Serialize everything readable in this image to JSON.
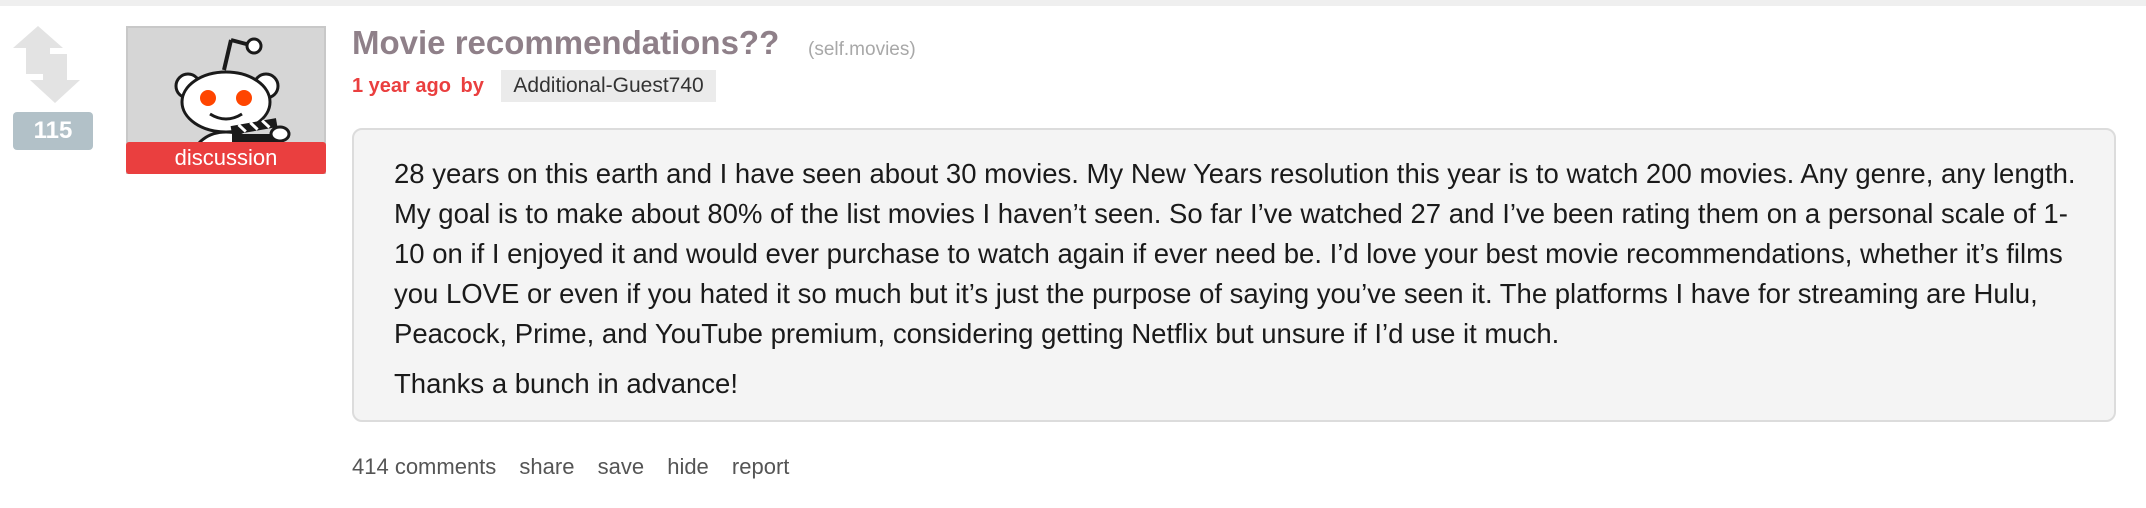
{
  "post": {
    "score": "115",
    "flair": "discussion",
    "title": "Movie recommendations??",
    "domain": "(self.movies)",
    "age": "1 year ago",
    "by_label": "by",
    "author": "Additional-Guest740",
    "body": [
      "28 years on this earth and I have seen about 30 movies. My New Years resolution this year is to watch 200 movies. Any genre, any length. My goal is to make about 80% of the list movies I haven’t seen. So far I’ve watched 27 and I’ve been rating them on a personal scale of 1-10 on if I enjoyed it and would ever purchase to watch again if ever need be. I’d love your best movie recommendations, whether it’s films you LOVE or even if you hated it so much but it’s just the purpose of saying you’ve seen it. The platforms I have for streaming are Hulu, Peacock, Prime, and YouTube premium, considering getting Netflix but unsure if I’d use it much.",
      "Thanks a bunch in advance!"
    ],
    "buttons": {
      "comments": "414 comments",
      "share": "share",
      "save": "save",
      "hide": "hide",
      "report": "report"
    }
  },
  "icons": {
    "upvote": "upvote-arrow-icon",
    "downvote": "downvote-arrow-icon",
    "thumbnail": "reddit-alien-clapperboard-icon"
  },
  "colors": {
    "flair_bg": "#ea3f3f",
    "tagline": "#ea3f3f",
    "title": "#8f8089",
    "score_bg": "#b2c1c8"
  }
}
